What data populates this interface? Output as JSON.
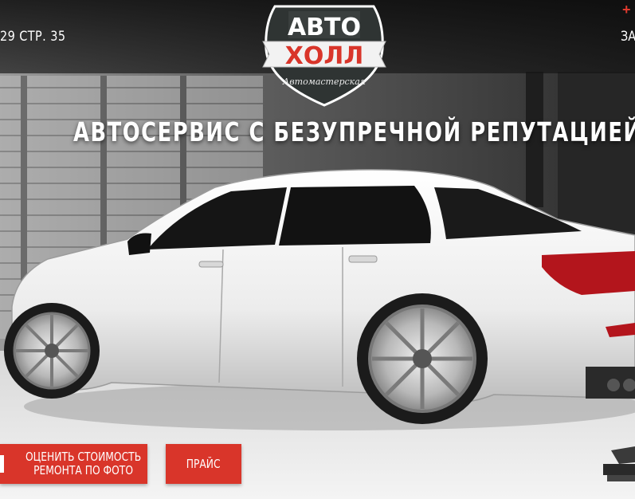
{
  "header": {
    "address_fragment": "29 СТР. 35",
    "right_fragment": "ЗА",
    "plus_symbol": "+"
  },
  "logo": {
    "line1": "АВТО",
    "line2": "ХОЛЛ",
    "tagline": "Автомастерская"
  },
  "hero": {
    "headline": "АВТОСЕРВИС С БЕЗУПРЕЧНОЙ РЕПУТАЦИЕЙ"
  },
  "buttons": {
    "estimate_line1": "ОЦЕНИТЬ СТОИМОСТЬ",
    "estimate_line2": "РЕМОНТА ПО ФОТО",
    "price": "ПРАЙС"
  },
  "colors": {
    "accent": "#d9352a",
    "logo_dark": "#2f3433",
    "text": "#ffffff"
  }
}
